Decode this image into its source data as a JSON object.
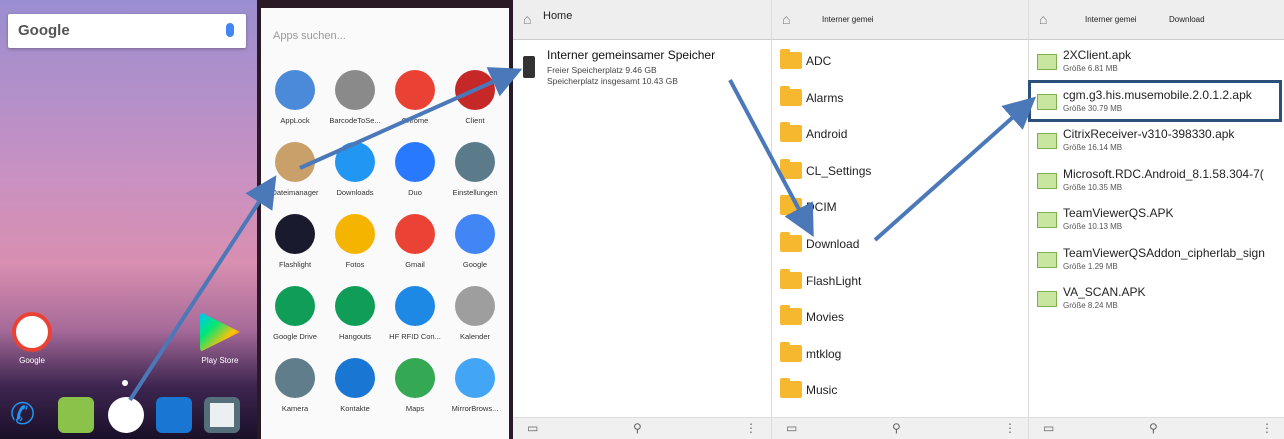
{
  "panel1": {
    "search_logo": "Google",
    "apps": [
      {
        "label": "Google",
        "icon": "google-icon"
      },
      {
        "label": "Play Store",
        "icon": "play-store-icon"
      }
    ],
    "dock": [
      "phone-icon",
      "messages-icon",
      "app-drawer-icon",
      "contacts-icon",
      "camera-icon"
    ]
  },
  "panel2": {
    "search_placeholder": "Apps suchen...",
    "apps": [
      {
        "label": "AppLock",
        "color": "#4a8ad8"
      },
      {
        "label": "BarcodeToSe...",
        "color": "#8a8a8a"
      },
      {
        "label": "Chrome",
        "color": "#e94235"
      },
      {
        "label": "Client",
        "color": "#c62828"
      },
      {
        "label": "Dateimanager",
        "color": "#c9a06a"
      },
      {
        "label": "Downloads",
        "color": "#2196f3"
      },
      {
        "label": "Duo",
        "color": "#2979ff"
      },
      {
        "label": "Einstellungen",
        "color": "#5b7b8a"
      },
      {
        "label": "Flashlight",
        "color": "#1a1a2e"
      },
      {
        "label": "Fotos",
        "color": "#f4b400"
      },
      {
        "label": "Gmail",
        "color": "#ea4335"
      },
      {
        "label": "Google",
        "color": "#4285f4"
      },
      {
        "label": "Google Drive",
        "color": "#0f9d58"
      },
      {
        "label": "Hangouts",
        "color": "#0f9d58"
      },
      {
        "label": "HF RFID Con...",
        "color": "#1e88e5"
      },
      {
        "label": "Kalender",
        "color": "#9e9e9e"
      },
      {
        "label": "Kamera",
        "color": "#607d8b"
      },
      {
        "label": "Kontakte",
        "color": "#1976d2"
      },
      {
        "label": "Maps",
        "color": "#34a853"
      },
      {
        "label": "MirrorBrows...",
        "color": "#42a5f5"
      }
    ]
  },
  "panel3": {
    "crumb": "Home",
    "storage_title": "Interner gemeinsamer Speicher",
    "free": "Freier Speicherplatz 9.46 GB",
    "total": "Speicherplatz insgesamt 10.43 GB"
  },
  "panel4": {
    "crumb": "Interner gemei",
    "folders": [
      "ADC",
      "Alarms",
      "Android",
      "CL_Settings",
      "DCIM",
      "Download",
      "FlashLight",
      "Movies",
      "mtklog",
      "Music"
    ]
  },
  "panel5": {
    "crumb1": "Interner gemei",
    "crumb2": "Download",
    "files": [
      {
        "name": "2XClient.apk",
        "size": "Größe 6.81 MB"
      },
      {
        "name": "cgm.g3.his.musemobile.2.0.1.2.apk",
        "size": "Größe 30.79 MB"
      },
      {
        "name": "CitrixReceiver-v310-398330.apk",
        "size": "Größe 16.14 MB"
      },
      {
        "name": "Microsoft.RDC.Android_8.1.58.304-7(",
        "size": "Größe 10.35 MB"
      },
      {
        "name": "TeamViewerQS.APK",
        "size": "Größe 10.13 MB"
      },
      {
        "name": "TeamViewerQSAddon_cipherlab_sign",
        "size": "Größe 1.29 MB"
      },
      {
        "name": "VA_SCAN.APK",
        "size": "Größe 8.24 MB"
      }
    ]
  }
}
